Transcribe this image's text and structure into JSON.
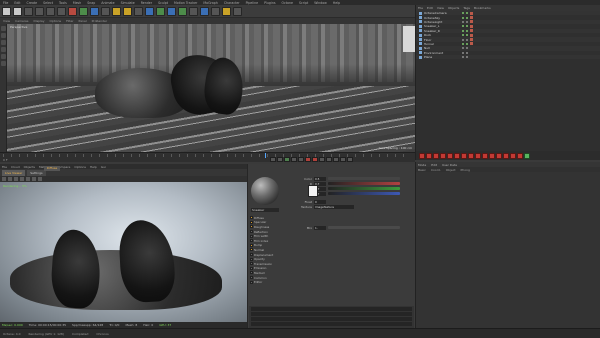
{
  "menubar": {
    "items": [
      "File",
      "Edit",
      "Create",
      "Select",
      "Tools",
      "Mesh",
      "Snap",
      "Animate",
      "Simulate",
      "Render",
      "Sculpt",
      "Motion Tracker",
      "MoGraph",
      "Character",
      "Pipeline",
      "Plugins",
      "Octane",
      "Script",
      "Window",
      "Help"
    ]
  },
  "toolbar2": {
    "items": [
      "View",
      "Cameras",
      "Display",
      "Options",
      "Filter",
      "Panel",
      "ProRender"
    ]
  },
  "viewport": {
    "title": "Perspective",
    "hud": "Grid Spacing : 100 cm"
  },
  "timeline": {
    "frame": "0 F"
  },
  "render_viewer": {
    "menu": [
      "File",
      "Cloud",
      "Objects",
      "Materials",
      "Compare",
      "Options",
      "Help",
      "Gui"
    ],
    "tabs": [
      "Live Viewer",
      "Settings"
    ],
    "active_tab": "Live Viewer",
    "status": "Rendering... 5%",
    "bottom": {
      "ms": "Ms/sec: 0.000",
      "time": "Time: 00:00:15/00:00:35",
      "spp": "Spp/maxspp: 64/128",
      "tri": "Tri: 0/0",
      "mesh": "Mesh: 8",
      "hair": "Hair: 0",
      "gpu": "GPU: 37"
    }
  },
  "material_editor": {
    "name": "Sneaker",
    "channels": [
      "Diffuse",
      "Specular",
      "Roughness",
      "Reflection",
      "Film width",
      "Film index",
      "Bump",
      "Normal",
      "Displacement",
      "Opacity",
      "Transmission",
      "Emission",
      "Medium",
      "Common",
      "Editor"
    ],
    "channel_on": [
      true,
      true,
      true,
      false,
      false,
      false,
      true,
      true,
      false,
      false,
      false,
      false,
      false,
      false,
      false
    ],
    "active_channel_header": "Diffuse",
    "color_sliders": [
      {
        "label": "Color",
        "value": "0.5",
        "color": "#ffffff"
      },
      {
        "label": "R",
        "value": "0.7",
        "color": "#b24141"
      },
      {
        "label": "G",
        "value": "0.7",
        "color": "#3c9a3c"
      },
      {
        "label": "B",
        "value": "0.7",
        "color": "#3d59b5"
      }
    ],
    "float_label": "Float",
    "float_value": "0",
    "texture_label": "Texture",
    "texture_value": "ImageTexture",
    "mix_label": "Mix",
    "mix_value": "1."
  },
  "object_manager": {
    "toolbar": [
      "File",
      "Edit",
      "View",
      "Objects",
      "Tags",
      "Bookmarks"
    ],
    "objects": [
      {
        "name": "OctaneCamera",
        "tag": "cam",
        "active": true
      },
      {
        "name": "OctaneSky",
        "tag": "sky",
        "active": true
      },
      {
        "name": "OctaneLight",
        "tag": "light",
        "active": false
      },
      {
        "name": "Sneaker_L",
        "tag": "mat",
        "active": true
      },
      {
        "name": "Sneaker_R",
        "tag": "mat",
        "active": true
      },
      {
        "name": "Rock",
        "tag": "mat",
        "active": true
      },
      {
        "name": "Floor",
        "tag": "mat",
        "active": false
      },
      {
        "name": "Tunnel",
        "tag": "mat",
        "active": true
      },
      {
        "name": "Null",
        "tag": "",
        "active": false
      },
      {
        "name": "Environment",
        "tag": "",
        "active": false
      },
      {
        "name": "Plane",
        "tag": "",
        "active": false
      }
    ],
    "tag_count_red": 15,
    "tag_count_green": 1
  },
  "attribute_manager": {
    "tabs": [
      "Mode",
      "Edit",
      "User Data"
    ],
    "tabs2": [
      "Basic",
      "Coord.",
      "Object",
      "Phong"
    ]
  },
  "statusbar": {
    "items": [
      "Octane: 4.0",
      "Rendering (GPU 1: 128)",
      "Completed",
      "Chronos"
    ]
  }
}
